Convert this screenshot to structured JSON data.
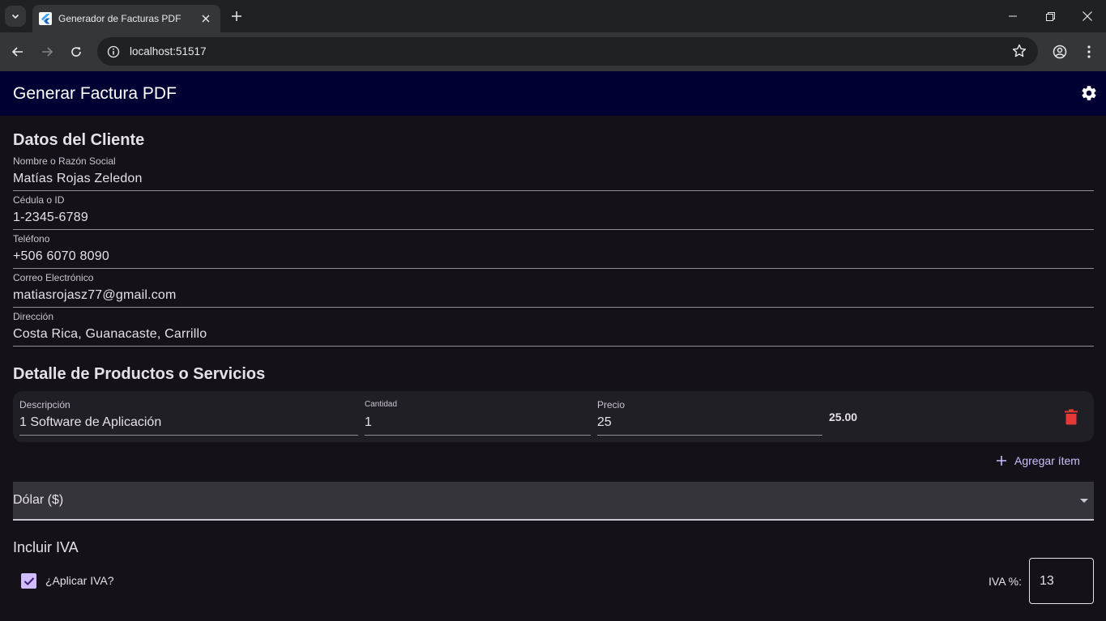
{
  "browser": {
    "tab_title": "Generador de Facturas PDF",
    "url": "localhost:51517"
  },
  "app": {
    "title": "Generar Factura PDF"
  },
  "client": {
    "section_title": "Datos del Cliente",
    "fields": [
      {
        "label": "Nombre o Razón Social",
        "value": "Matías Rojas Zeledon"
      },
      {
        "label": "Cédula o ID",
        "value": "1-2345-6789"
      },
      {
        "label": "Teléfono",
        "value": "+506 6070 8090"
      },
      {
        "label": "Correo Electrónico",
        "value": "matiasrojasz77@gmail.com"
      },
      {
        "label": "Dirección",
        "value": "Costa Rica, Guanacaste, Carrillo"
      }
    ]
  },
  "products": {
    "section_title": "Detalle de Productos o Servicios",
    "items": [
      {
        "description_label": "Descripción",
        "description": "1 Software de Aplicación",
        "quantity_label": "Cantidad",
        "quantity": "1",
        "price_label": "Precio",
        "price": "25",
        "total": "25.00"
      }
    ],
    "add_item_label": "Agregar ítem"
  },
  "currency": {
    "selected": "Dólar ($)"
  },
  "iva": {
    "section_title": "Incluir IVA",
    "apply_label": "¿Aplicar IVA?",
    "apply_checked": true,
    "percent_label": "IVA %:",
    "percent_value": "13"
  },
  "colors": {
    "appbar_bg": "#000033",
    "accent": "#d0bcff",
    "delete": "#e53935",
    "background": "#141218"
  }
}
